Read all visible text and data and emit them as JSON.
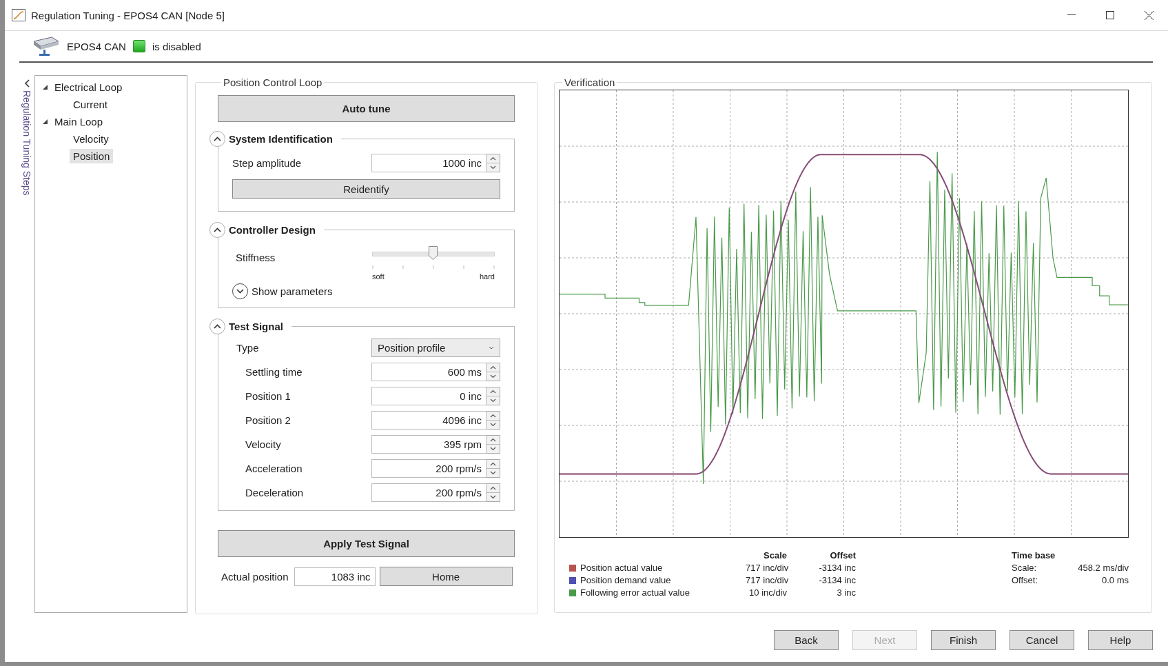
{
  "window": {
    "title": "Regulation Tuning - EPOS4 CAN [Node 5]"
  },
  "device": {
    "name": "EPOS4 CAN",
    "indicator_on": true,
    "status": "is disabled"
  },
  "steps_rail": {
    "label": "Regulation Tuning Steps"
  },
  "tree": [
    {
      "label": "Electrical Loop",
      "expanded": true,
      "selected": false,
      "children": [
        {
          "label": "Current",
          "selected": false
        }
      ]
    },
    {
      "label": "Main Loop",
      "expanded": true,
      "selected": false,
      "children": [
        {
          "label": "Velocity",
          "selected": false
        },
        {
          "label": "Position",
          "selected": true
        }
      ]
    }
  ],
  "control_loop": {
    "title": "Position Control Loop",
    "auto_tune_button": "Auto tune",
    "system_identification": {
      "title": "System Identification",
      "expanded": true,
      "fields": [
        {
          "label": "Step amplitude",
          "value": "1000 inc"
        }
      ],
      "button": "Reidentify"
    },
    "controller_design": {
      "title": "Controller Design",
      "expanded": true,
      "stiffness": {
        "label": "Stiffness",
        "level": 0.5,
        "min_label": "soft",
        "max_label": "hard"
      },
      "show_parameters": {
        "label": "Show parameters",
        "expanded": false
      }
    },
    "test_signal": {
      "title": "Test Signal",
      "expanded": true,
      "type": {
        "label": "Type",
        "value": "Position profile"
      },
      "fields": [
        {
          "label": "Settling time",
          "value": "600 ms"
        },
        {
          "label": "Position 1",
          "value": "0 inc"
        },
        {
          "label": "Position 2",
          "value": "4096 inc"
        },
        {
          "label": "Velocity",
          "value": "395 rpm"
        },
        {
          "label": "Acceleration",
          "value": "200 rpm/s"
        },
        {
          "label": "Deceleration",
          "value": "200 rpm/s"
        }
      ]
    },
    "apply_button": "Apply Test Signal",
    "actual_position": {
      "label": "Actual position",
      "value": "1083 inc"
    },
    "home_button": "Home"
  },
  "verification": {
    "title": "Verification",
    "scale_header": "Scale",
    "offset_header": "Offset",
    "series": [
      {
        "name": "Position actual value",
        "color": "#b85450",
        "scale": "717 inc/div",
        "offset": "-3134 inc"
      },
      {
        "name": "Position demand value",
        "color": "#5050b4",
        "scale": "717 inc/div",
        "offset": "-3134 inc"
      },
      {
        "name": "Following error actual value",
        "color": "#4a9a4a",
        "scale": "10 inc/div",
        "offset": "3 inc"
      }
    ],
    "time_base": {
      "title": "Time base",
      "rows": [
        {
          "label": "Scale:",
          "value": "458.2 ms/div"
        },
        {
          "label": "Offset:",
          "value": "0.0 ms"
        }
      ]
    }
  },
  "buttons": [
    {
      "label": "Back",
      "disabled": false
    },
    {
      "label": "Next",
      "disabled": true
    },
    {
      "label": "Finish",
      "disabled": false
    },
    {
      "label": "Cancel",
      "disabled": false
    },
    {
      "label": "Help",
      "disabled": false
    }
  ]
}
